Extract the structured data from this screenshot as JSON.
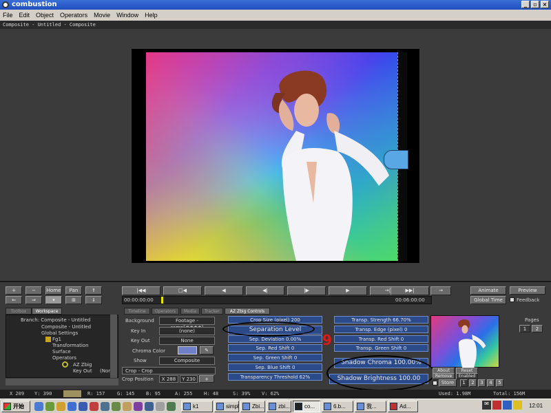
{
  "window": {
    "title": "combustion"
  },
  "menu": [
    "File",
    "Edit",
    "Object",
    "Operators",
    "Movie",
    "Window",
    "Help"
  ],
  "composite_title": "Composite - Untitled - Composite",
  "transport": {
    "left_buttons": [
      "Home",
      "Pan"
    ],
    "time_start": "00:00:00:00",
    "time_end": "00:06:00:00",
    "animate_label": "Animate",
    "preview_label": "Preview",
    "global_time_label": "Global Time",
    "feedback_label": "Feedback"
  },
  "tabs_left": [
    "Toolbox",
    "Workspace"
  ],
  "tree": [
    "Branch: Composite - Untitled",
    "Composite - Untitled",
    "Global Settings",
    "Fg1",
    "Transformation",
    "Surface",
    "Operators",
    "AZ Zbig",
    "Key Out",
    "(None"
  ],
  "layer_props": {
    "background_label": "Background",
    "background_value": "Footage - ramp[####]",
    "key_in_label": "Key In",
    "key_in_value": "(none)",
    "key_out_label": "Key Out",
    "key_out_value": "None",
    "chroma_color_label": "Chroma Color",
    "show_label": "Show",
    "show_value": "Composite",
    "crop_label": "Crop - Crop",
    "crop_position_label": "Crop Position",
    "crop_x": "X 288",
    "crop_y": "Y 230"
  },
  "mid_tabs": [
    "Timeline",
    "Operators",
    "Media",
    "Tracker",
    "AZ Zbig Controls"
  ],
  "controls_left": [
    "Crop Size (pixel) 200",
    "Separation Level",
    "Sep. Deviation 0.00%",
    "Sep. Red Shift 0",
    "Sep. Green Shift 0",
    "Sep. Blue Shift 0",
    "Transparency Threshold 62%"
  ],
  "controls_right": [
    "Transp. Strength 66.70%",
    "Transp. Edge (pixel) 0",
    "Transp. Red Shift 0",
    "Transp. Green Shift 0",
    "Shadow Chroma 100.00%",
    "Shadow Brightness 100.00"
  ],
  "annotation_number": "9",
  "thumb_buttons": [
    "About",
    "Reset",
    "Remove",
    "Enabled",
    "Store"
  ],
  "store_slots": [
    "1",
    "2",
    "3",
    "4",
    "5"
  ],
  "pages": {
    "label": "Pages",
    "items": [
      "1",
      "2"
    ]
  },
  "status": {
    "x": "X 209",
    "y": "Y: 390",
    "r": "R: 157",
    "g": "G: 145",
    "b": "B: 95",
    "a": "A: 255",
    "h": "H: 48",
    "s": "S: 39%",
    "v": "V: 62%",
    "used": "Used: 1.98M",
    "total": "Total: 156M"
  },
  "taskbar": {
    "start": "开始",
    "tasks": [
      "k1",
      "simple",
      "Zbi...",
      "zbi...",
      "co...",
      "6.b...",
      "我...",
      "Ad..."
    ],
    "clock": "12:01"
  }
}
